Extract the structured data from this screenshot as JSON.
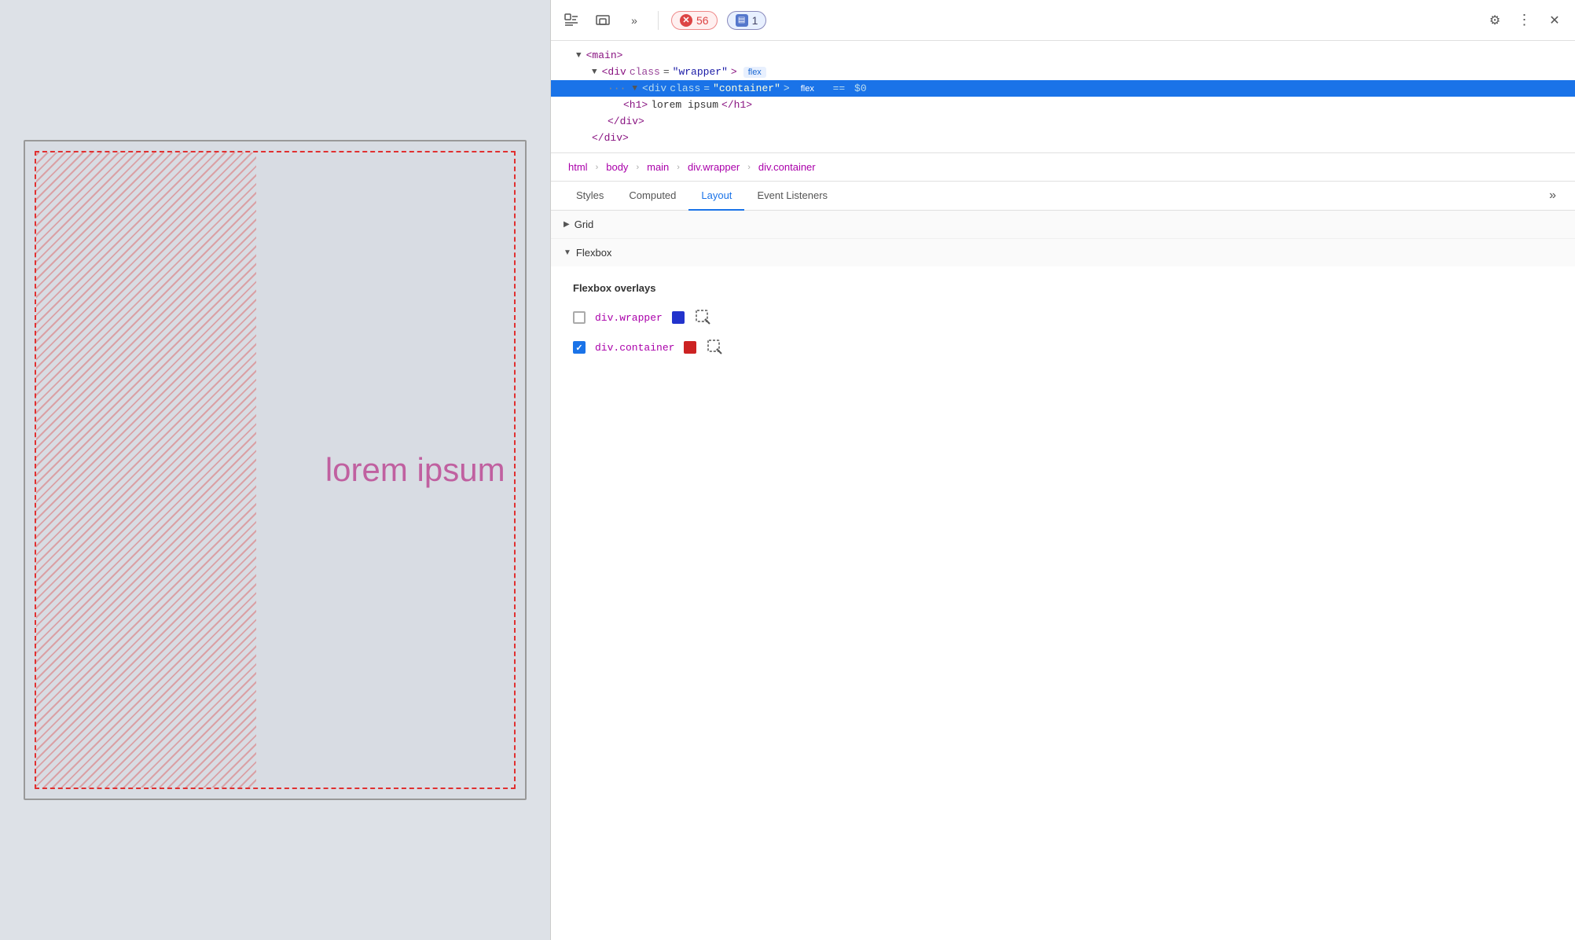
{
  "viewport": {
    "lorem_text": "lorem ipsum"
  },
  "devtools": {
    "toolbar": {
      "inspector_label": "⬡",
      "responsive_label": "▭",
      "more_label": "»",
      "error_count": "56",
      "comment_count": "1",
      "settings_label": "⚙",
      "more_options_label": "⋮",
      "close_label": "✕"
    },
    "dom_tree": {
      "lines": [
        {
          "indent": "indent1",
          "content": "▼<main>",
          "selected": false
        },
        {
          "indent": "indent2",
          "content": "▼<div class=\"wrapper\">",
          "badge": "flex",
          "selected": false
        },
        {
          "indent": "indent3",
          "content": "▼<div class=\"container\">",
          "badge_blue": "flex",
          "equals": "==",
          "dollar": "$0",
          "selected": true,
          "dots": "···"
        },
        {
          "indent": "indent4",
          "content": "<h1>lorem ipsum</h1>",
          "selected": false
        },
        {
          "indent": "indent3",
          "content": "</div>",
          "selected": false
        },
        {
          "indent": "indent2",
          "content": "</div>",
          "selected": false
        }
      ]
    },
    "breadcrumb": {
      "items": [
        "html",
        "body",
        "main",
        "div.wrapper",
        "div.container"
      ]
    },
    "tabs": {
      "items": [
        "Styles",
        "Computed",
        "Layout",
        "Event Listeners"
      ],
      "active": "Layout"
    },
    "layout": {
      "grid_label": "Grid",
      "flexbox_label": "Flexbox",
      "flexbox_overlays_title": "Flexbox overlays",
      "overlays": [
        {
          "id": "wrapper",
          "checked": false,
          "label": "div.wrapper",
          "color": "#2233cc",
          "icon": "cursor"
        },
        {
          "id": "container",
          "checked": true,
          "label": "div.container",
          "color": "#cc2222",
          "icon": "cursor"
        }
      ]
    }
  }
}
